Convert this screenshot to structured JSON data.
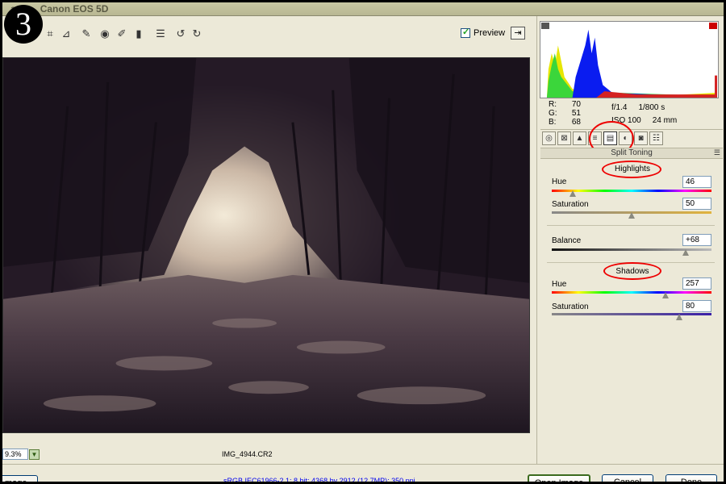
{
  "window": {
    "title": "ay 1... Canon EOS 5D",
    "step_number": "3"
  },
  "toolbar": {
    "preview_label": "Preview",
    "preview_checked": true,
    "tools": [
      "crop-icon",
      "straighten-icon",
      "spot-removal-icon",
      "red-eye-icon",
      "adjustment-brush-icon",
      "graduated-filter-icon",
      "preferences-icon",
      "rotate-left-icon",
      "rotate-right-icon"
    ]
  },
  "canvas": {
    "zoom_value": "9.3%",
    "filename": "IMG_4944.CR2"
  },
  "histogram": {
    "rgb": {
      "r_label": "R:",
      "r_value": "70",
      "g_label": "G:",
      "g_value": "51",
      "b_label": "B:",
      "b_value": "68"
    },
    "exif": {
      "aperture": "f/1.4",
      "shutter": "1/800 s",
      "iso": "ISO 100",
      "focal": "24 mm"
    }
  },
  "panel": {
    "section_title": "Split Toning",
    "highlights_label": "Highlights",
    "shadows_label": "Shadows",
    "sliders": {
      "highlights_hue": {
        "label": "Hue",
        "value": "46",
        "level": 0.13
      },
      "highlights_saturation": {
        "label": "Saturation",
        "value": "50",
        "level": 0.5
      },
      "balance": {
        "label": "Balance",
        "value": "+68",
        "level": 0.84
      },
      "shadows_hue": {
        "label": "Hue",
        "value": "257",
        "level": 0.71
      },
      "shadows_saturation": {
        "label": "Saturation",
        "value": "80",
        "level": 0.8
      }
    }
  },
  "footer": {
    "save_label": "mage...",
    "info_link": "sRGB IEC61966-2.1; 8 bit; 4368 by 2912 (12.7MP); 350 ppi",
    "open_label": "Open Image",
    "cancel_label": "Cancel",
    "done_label": "Done"
  },
  "colors": {
    "annotation": "#e00000",
    "highlight_tint": "#e8d6b8",
    "shadow_tint": "#2b1f2e"
  }
}
